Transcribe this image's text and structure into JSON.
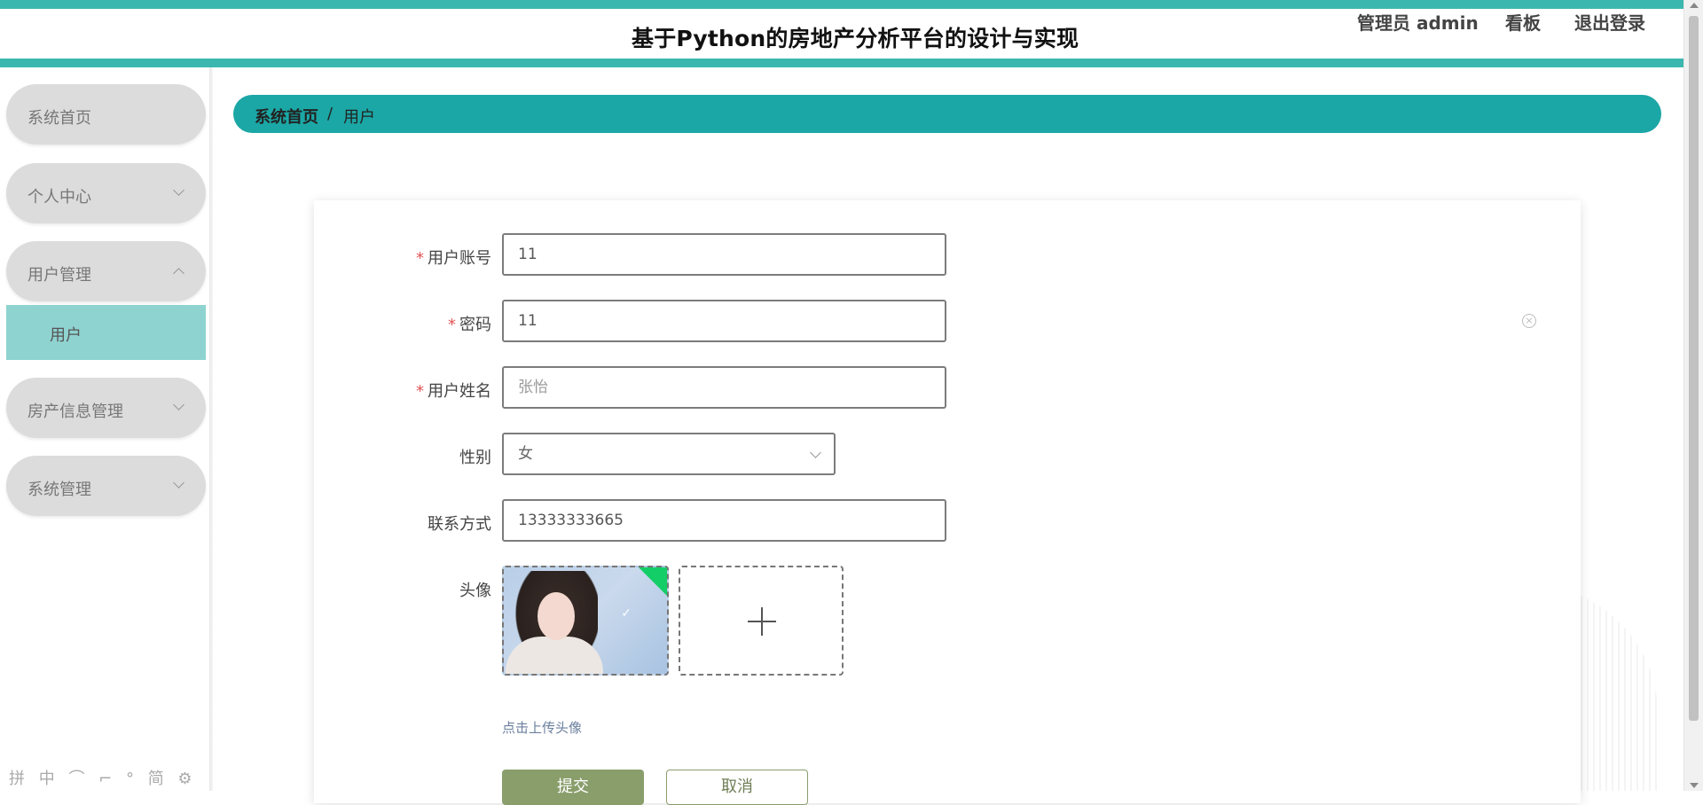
{
  "header": {
    "title": "基于Python的房地产分析平台的设计与实现",
    "user_label": "管理员 admin",
    "dashboard_link": "看板",
    "logout_link": "退出登录"
  },
  "sidebar": {
    "items": [
      {
        "label": "系统首页"
      },
      {
        "label": "个人中心"
      },
      {
        "label": "用户管理"
      },
      {
        "label": "房产信息管理"
      },
      {
        "label": "系统管理"
      }
    ],
    "active_sub_item": "用户"
  },
  "breadcrumb": {
    "home": "系统首页",
    "separator": "/",
    "current": "用户"
  },
  "form": {
    "account": {
      "label": "用户账号",
      "value": "11",
      "required": "*"
    },
    "password": {
      "label": "密码",
      "value": "11",
      "required": "*"
    },
    "name": {
      "label": "用户姓名",
      "placeholder": "张怡",
      "required": "*"
    },
    "gender": {
      "label": "性别",
      "value": "女"
    },
    "contact": {
      "label": "联系方式",
      "value": "13333333665"
    },
    "avatar": {
      "label": "头像",
      "upload_tip": "点击上传头像"
    }
  },
  "buttons": {
    "submit": "提交",
    "cancel": "取消"
  },
  "colors": {
    "accent": "#1ba7a5",
    "header_stripe": "#3cb7b0",
    "submenu_active": "#8fd3d0",
    "submit_button": "#8a9e6c"
  },
  "ime_toolbar": "拼 中 ⌒ ⌐ ° 简 ⚙"
}
